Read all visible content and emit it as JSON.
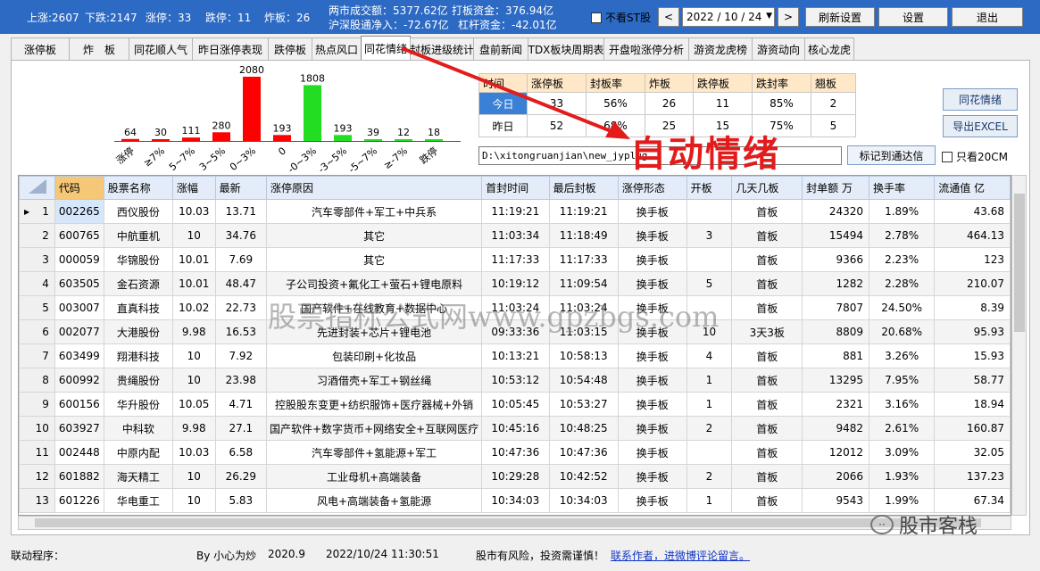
{
  "top": {
    "up": "上涨:2607",
    "down": "下跌:2147",
    "limit_up": "涨停：33",
    "limit_down": "跌停：11",
    "broken": "炸板：26",
    "turnover": "两市成交额：5377.62亿",
    "hk_flow": "沪深股通净入：-72.67亿",
    "board_fund": "打板资金：376.94亿",
    "lever_fund": "杠杆资金：-42.01亿",
    "no_st_label": "不看ST股",
    "prev_arrow": "<",
    "date": "2022 / 10 / 24",
    "next_arrow": ">",
    "refresh_btn": "刷新设置",
    "settings_btn": "设置",
    "exit_btn": "退出"
  },
  "tabs": [
    "涨停板",
    "炸　板",
    "同花顺人气",
    "昨日涨停表现",
    "跌停板",
    "热点风口",
    "同花情绪",
    "封板进级统计",
    "盘前新闻",
    "TDX板块周期表",
    "开盘啦涨停分析",
    "游资龙虎榜",
    "游资动向",
    "核心龙虎"
  ],
  "active_tab": 6,
  "chart_data": {
    "type": "bar",
    "categories": [
      "涨停",
      "≥7%",
      "5~7%",
      "3~5%",
      "0~3%",
      "0",
      "-0~3%",
      "-3~5%",
      "-5~7%",
      "≥-7%",
      "跌停"
    ],
    "values": [
      64,
      30,
      111,
      280,
      2080,
      193,
      1808,
      193,
      39,
      12,
      18
    ],
    "colors": [
      "#ff0000",
      "#ff0000",
      "#ff0000",
      "#ff0000",
      "#ff0000",
      "#ff0000",
      "#22dd22",
      "#22dd22",
      "#22dd22",
      "#22dd22",
      "#22dd22"
    ],
    "ylim": [
      0,
      2080
    ]
  },
  "summary": {
    "headers": [
      "时间",
      "涨停板",
      "封板率",
      "炸板",
      "跌停板",
      "跌封率",
      "翘板"
    ],
    "rows": [
      [
        "今日",
        "33",
        "56%",
        "26",
        "11",
        "85%",
        "2"
      ],
      [
        "昨日",
        "52",
        "68%",
        "25",
        "15",
        "75%",
        "5"
      ]
    ]
  },
  "side": {
    "ths_btn": "同花情绪",
    "export_btn": "导出EXCEL",
    "mark_btn": "标记到通达信",
    "only20_label": "只看20CM"
  },
  "path_value": "D:\\xitongruanjian\\new_jyplug",
  "annotation": "自动情绪",
  "grid": {
    "headers": [
      "代码",
      "股票名称",
      "涨幅",
      "最新",
      "涨停原因",
      "首封时间",
      "最后封板",
      "涨停形态",
      "开板",
      "几天几板",
      "封单额 万",
      "换手率",
      "流通值 亿"
    ],
    "rows": [
      [
        "1",
        "002265",
        "西仪股份",
        "10.03",
        "13.71",
        "汽车零部件+军工+中兵系",
        "11:19:21",
        "11:19:21",
        "换手板",
        "",
        "首板",
        "24320",
        "1.89%",
        "43.68"
      ],
      [
        "2",
        "600765",
        "中航重机",
        "10",
        "34.76",
        "其它",
        "11:03:34",
        "11:18:49",
        "换手板",
        "3",
        "首板",
        "15494",
        "2.78%",
        "464.13"
      ],
      [
        "3",
        "000059",
        "华锦股份",
        "10.01",
        "7.69",
        "其它",
        "11:17:33",
        "11:17:33",
        "换手板",
        "",
        "首板",
        "9366",
        "2.23%",
        "123"
      ],
      [
        "4",
        "603505",
        "金石资源",
        "10.01",
        "48.47",
        "子公司投资+氟化工+萤石+锂电原料",
        "10:19:12",
        "11:09:54",
        "换手板",
        "5",
        "首板",
        "1282",
        "2.28%",
        "210.07"
      ],
      [
        "5",
        "003007",
        "直真科技",
        "10.02",
        "22.73",
        "国产软件+在线教育+数据中心",
        "11:03:24",
        "11:03:24",
        "换手板",
        "",
        "首板",
        "7807",
        "24.50%",
        "8.39"
      ],
      [
        "6",
        "002077",
        "大港股份",
        "9.98",
        "16.53",
        "先进封装+芯片+锂电池",
        "09:33:36",
        "11:03:15",
        "换手板",
        "10",
        "3天3板",
        "8809",
        "20.68%",
        "95.93"
      ],
      [
        "7",
        "603499",
        "翔港科技",
        "10",
        "7.92",
        "包装印刷+化妆品",
        "10:13:21",
        "10:58:13",
        "换手板",
        "4",
        "首板",
        "881",
        "3.26%",
        "15.93"
      ],
      [
        "8",
        "600992",
        "贵绳股份",
        "10",
        "23.98",
        "习酒借壳+军工+钢丝绳",
        "10:53:12",
        "10:54:48",
        "换手板",
        "1",
        "首板",
        "13295",
        "7.95%",
        "58.77"
      ],
      [
        "9",
        "600156",
        "华升股份",
        "10.05",
        "4.71",
        "控股股东变更+纺织服饰+医疗器械+外销",
        "10:05:45",
        "10:53:27",
        "换手板",
        "1",
        "首板",
        "2321",
        "3.16%",
        "18.94"
      ],
      [
        "10",
        "603927",
        "中科软",
        "9.98",
        "27.1",
        "国产软件+数字货币+网络安全+互联网医疗",
        "10:45:16",
        "10:48:25",
        "换手板",
        "2",
        "首板",
        "9482",
        "2.61%",
        "160.87"
      ],
      [
        "11",
        "002448",
        "中原内配",
        "10.03",
        "6.58",
        "汽车零部件+氢能源+军工",
        "10:47:36",
        "10:47:36",
        "换手板",
        "",
        "首板",
        "12012",
        "3.09%",
        "32.05"
      ],
      [
        "12",
        "601882",
        "海天精工",
        "10",
        "26.29",
        "工业母机+高端装备",
        "10:29:28",
        "10:42:52",
        "换手板",
        "2",
        "首板",
        "2066",
        "1.93%",
        "137.23"
      ],
      [
        "13",
        "601226",
        "华电重工",
        "10",
        "5.83",
        "风电+高端装备+氢能源",
        "10:34:03",
        "10:34:03",
        "换手板",
        "1",
        "首板",
        "9543",
        "1.99%",
        "67.34"
      ]
    ]
  },
  "watermark": "股票指标公式网www.gpzbgs.com",
  "wechat": "股市客栈",
  "status": {
    "label": "联动程序：",
    "author": "By 小心为炒",
    "version": "2020.9",
    "datetime": "2022/10/24 11:30:51",
    "risk": "股市有风险，投资需谨慎！",
    "contact": "联系作者，进微博评论留言。"
  }
}
